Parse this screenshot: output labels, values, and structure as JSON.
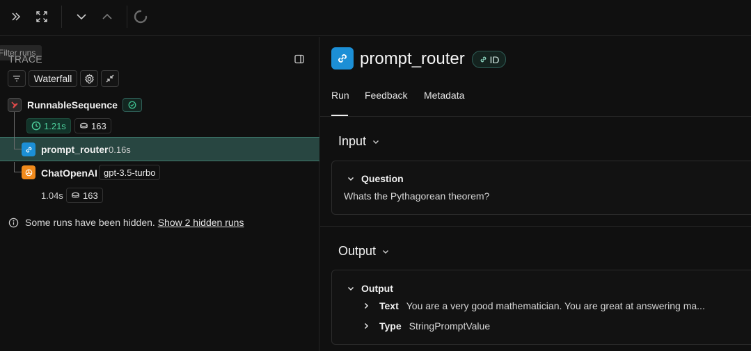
{
  "toolbar": {
    "icons": [
      "expand-panel-icon",
      "fullscreen-icon",
      "chevron-down-icon",
      "chevron-up-icon",
      "loading-spinner-icon"
    ]
  },
  "trace": {
    "title": "TRACE",
    "filter_ghost": "Filter runs",
    "view_mode": "Waterfall",
    "nodes": [
      {
        "name": "RunnableSequence",
        "status_icon": "check-circle-icon",
        "latency": "1.21s",
        "tokens": "163"
      },
      {
        "name": "prompt_router",
        "latency": "0.16s",
        "selected": true
      },
      {
        "name": "ChatOpenAI",
        "model": "gpt-3.5-turbo",
        "latency": "1.04s",
        "tokens": "163"
      }
    ],
    "hidden_note": "Some runs have been hidden.",
    "hidden_link": "Show 2 hidden runs"
  },
  "run": {
    "title": "prompt_router",
    "id_badge": "ID",
    "tabs": [
      "Run",
      "Feedback",
      "Metadata"
    ],
    "active_tab": "Run",
    "input": {
      "title": "Input",
      "field": "Question",
      "value": "Whats the Pythagorean theorem?"
    },
    "output": {
      "title": "Output",
      "field": "Output",
      "items": [
        {
          "key": "Text",
          "value": "You are a very good mathematician. You are great at answering ma..."
        },
        {
          "key": "Type",
          "value": "StringPromptValue"
        }
      ]
    }
  },
  "colors": {
    "accent_green": "#3fbf8f",
    "selected_row": "#284641",
    "link_icon_bg": "#1c8fd6",
    "openai_icon_bg": "#f08a1c",
    "sequence_icon_bg": "#2a2a2a"
  }
}
